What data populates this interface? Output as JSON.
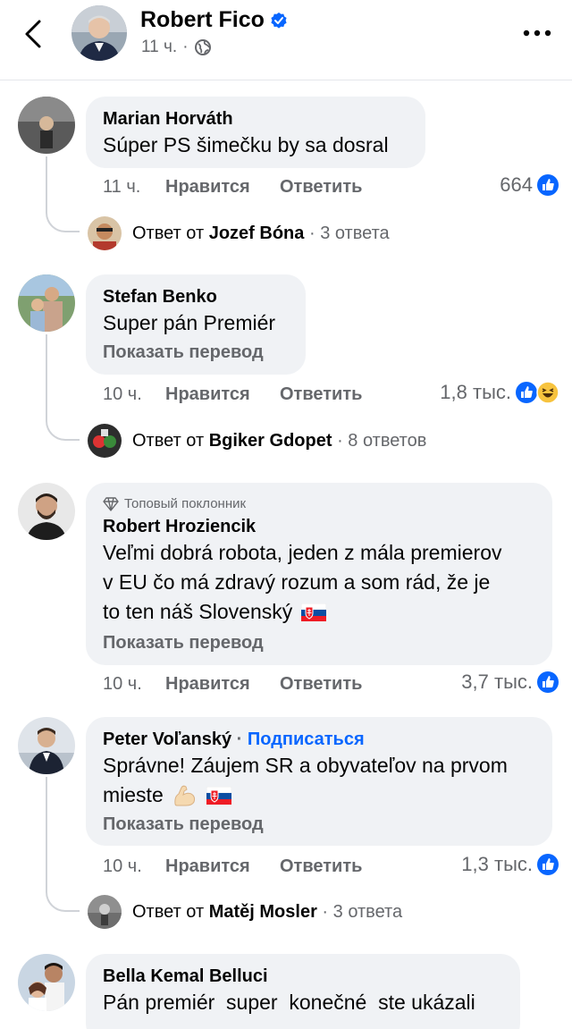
{
  "header": {
    "page_name": "Robert Fico",
    "time": "11 ч.",
    "separator": "·",
    "audience_icon": "globe-icon",
    "verified_icon": "verified-badge-icon"
  },
  "labels": {
    "like": "Нравится",
    "reply": "Ответить",
    "show_translation": "Показать перевод",
    "reply_by": "Ответ от",
    "dot": "·"
  },
  "comments": [
    {
      "author": "Marian Horváth",
      "text": "Súper PS šimečku by sa dosral",
      "time": "11 ч.",
      "reactions_count": "664",
      "reaction_icons": [
        "like-icon"
      ],
      "replies": {
        "name": "Jozef Bóna",
        "count": "3 ответа"
      }
    },
    {
      "author": "Stefan Benko",
      "text": "Super pán Premiér",
      "time": "10 ч.",
      "reactions_count": "1,8 тыс.",
      "reaction_icons": [
        "like-icon",
        "haha-icon"
      ],
      "replies": {
        "name": "Bgiker Gdopet",
        "count": "8 ответов"
      }
    },
    {
      "badge": "Топовый поклонник",
      "author": "Robert Hroziencik",
      "text_lines": [
        "Veľmi dobrá robota, jeden z mála premierov",
        "v EU čo má zdravý rozum a som rád, že je",
        "to ten náš Slovenský"
      ],
      "time": "10 ч.",
      "reactions_count": "3,7 тыс.",
      "reaction_icons": [
        "like-icon"
      ]
    },
    {
      "author": "Peter Voľanský",
      "follow_label": "Подписаться",
      "text_lines": [
        "Správne! Záujem SR a obyvateľov na prvom",
        "mieste"
      ],
      "time": "10 ч.",
      "reactions_count": "1,3 тыс.",
      "reaction_icons": [
        "like-icon"
      ],
      "replies": {
        "name": "Matěj Mosler",
        "count": "3 ответа"
      }
    },
    {
      "author": "Bella Kemal Belluci",
      "text": "Pán premiér  super  konečné  ste ukázali"
    }
  ],
  "colors": {
    "accent": "#0866ff",
    "bubble": "#f0f2f5",
    "secondary_text": "#65676b"
  }
}
